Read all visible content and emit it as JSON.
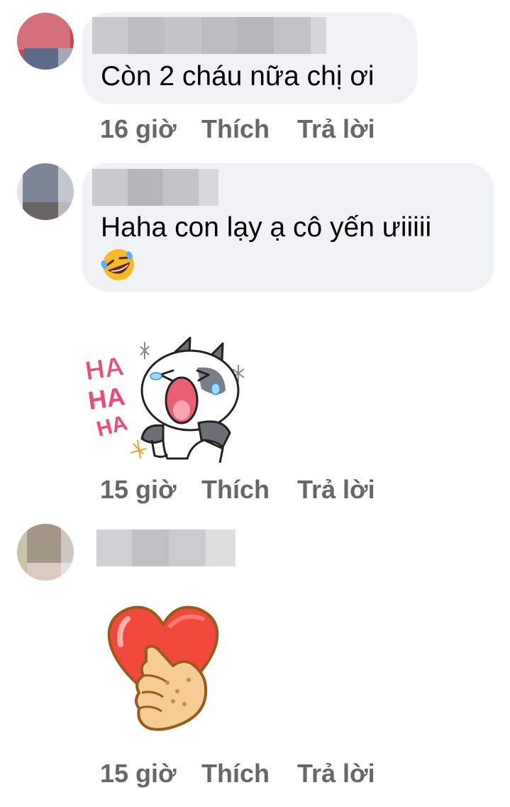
{
  "comments": [
    {
      "text": "Còn 2 cháu nữa chị ơi",
      "time": "16 giờ",
      "like_label": "Thích",
      "reply_label": "Trả lời"
    },
    {
      "text": "Haha con lạy ạ cô yến ưiiiii",
      "emoji": "🤣",
      "time": "15 giờ",
      "like_label": "Thích",
      "reply_label": "Trả lời",
      "sticker": {
        "name": "laughing-cat-sticker",
        "ha_text": [
          "HA",
          "HA",
          "HA"
        ]
      }
    },
    {
      "time": "15 giờ",
      "like_label": "Thích",
      "reply_label": "Trả lời",
      "sticker": {
        "name": "heart-hand-sticker"
      }
    }
  ],
  "colors": {
    "bubble_bg": "#f0f2f5",
    "meta_text": "#65676b",
    "body_text": "#050505",
    "ha_pink": "#ee4a72",
    "heart_red": "#f0493c"
  }
}
